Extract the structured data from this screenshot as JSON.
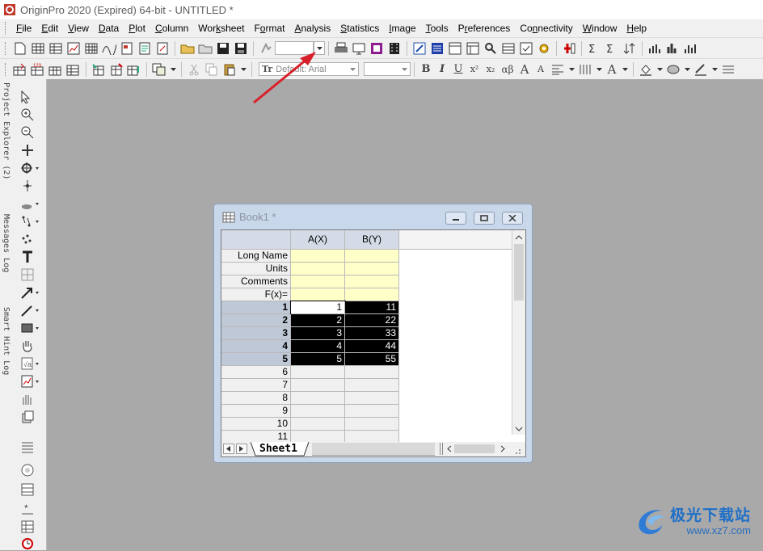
{
  "window": {
    "title": "OriginPro 2020 (Expired) 64-bit - UNTITLED *"
  },
  "menu": {
    "items": [
      {
        "pre": "",
        "ul": "F",
        "post": "ile"
      },
      {
        "pre": "",
        "ul": "E",
        "post": "dit"
      },
      {
        "pre": "",
        "ul": "V",
        "post": "iew"
      },
      {
        "pre": "",
        "ul": "D",
        "post": "ata"
      },
      {
        "pre": "",
        "ul": "P",
        "post": "lot"
      },
      {
        "pre": "",
        "ul": "C",
        "post": "olumn"
      },
      {
        "pre": "Wor",
        "ul": "k",
        "post": "sheet"
      },
      {
        "pre": "F",
        "ul": "o",
        "post": "rmat"
      },
      {
        "pre": "",
        "ul": "A",
        "post": "nalysis"
      },
      {
        "pre": "",
        "ul": "S",
        "post": "tatistics"
      },
      {
        "pre": "",
        "ul": "I",
        "post": "mage"
      },
      {
        "pre": "",
        "ul": "T",
        "post": "ools"
      },
      {
        "pre": "P",
        "ul": "r",
        "post": "eferences"
      },
      {
        "pre": "Co",
        "ul": "n",
        "post": "nectivity"
      },
      {
        "pre": "",
        "ul": "W",
        "post": "indow"
      },
      {
        "pre": "",
        "ul": "H",
        "post": "elp"
      }
    ]
  },
  "format_toolbar": {
    "font_placeholder": "Default: Arial",
    "bold": "B",
    "italic": "I",
    "underline": "U",
    "superscript": "x²",
    "subscript": "x₂",
    "greek": "αβ",
    "enlarge": "A",
    "shrink": "A"
  },
  "side_tabs": {
    "project_explorer": "Project Explorer (2)",
    "messages_log": "Messages Log",
    "smart_hint_log": "Smart Hint Log"
  },
  "book": {
    "title": "Book1 *",
    "columns": [
      "A(X)",
      "B(Y)"
    ],
    "label_rows": [
      "Long Name",
      "Units",
      "Comments",
      "F(x)="
    ],
    "rows": [
      {
        "n": "1",
        "a": "1",
        "b": "11"
      },
      {
        "n": "2",
        "a": "2",
        "b": "22"
      },
      {
        "n": "3",
        "a": "3",
        "b": "33"
      },
      {
        "n": "4",
        "a": "4",
        "b": "44"
      },
      {
        "n": "5",
        "a": "5",
        "b": "55"
      },
      {
        "n": "6",
        "a": "",
        "b": ""
      },
      {
        "n": "7",
        "a": "",
        "b": ""
      },
      {
        "n": "8",
        "a": "",
        "b": ""
      },
      {
        "n": "9",
        "a": "",
        "b": ""
      },
      {
        "n": "10",
        "a": "",
        "b": ""
      },
      {
        "n": "11",
        "a": "",
        "b": ""
      }
    ],
    "sheet_tab": "Sheet1"
  },
  "watermark": {
    "brand": "极光下载站",
    "url": "www.xz7.com"
  },
  "colors": {
    "annotation_arrow": "#d9202a",
    "label_row_fill": "#ffffc8",
    "selection_fill": "#000000"
  }
}
